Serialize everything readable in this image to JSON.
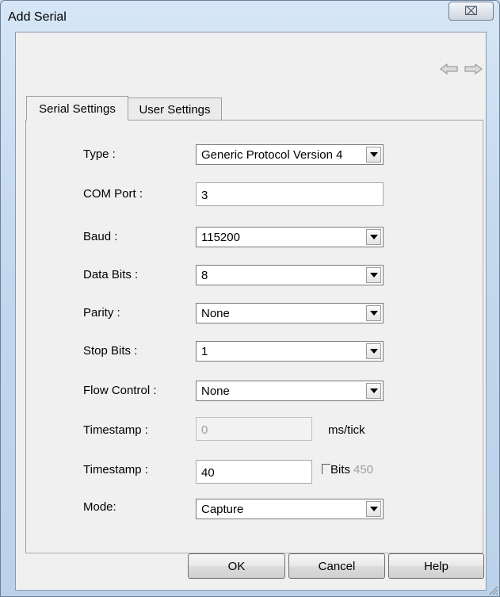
{
  "window": {
    "title": "Add Serial",
    "close_glyph": "⌧"
  },
  "nav": {
    "back_icon": "back-arrow-icon",
    "forward_icon": "forward-arrow-icon"
  },
  "tabs": [
    {
      "label": "Serial Settings",
      "active": true
    },
    {
      "label": "User Settings",
      "active": false
    }
  ],
  "fields": {
    "type": {
      "label": "Type :",
      "value": "Generic Protocol Version 4"
    },
    "com_port": {
      "label": "COM Port :",
      "value": "3"
    },
    "baud": {
      "label": "Baud :",
      "value": "115200"
    },
    "data_bits": {
      "label": "Data Bits :",
      "value": "8"
    },
    "parity": {
      "label": "Parity :",
      "value": "None"
    },
    "stop_bits": {
      "label": "Stop Bits :",
      "value": "1"
    },
    "flow_control": {
      "label": "Flow Control :",
      "value": "None"
    },
    "timestamp_ms": {
      "label": "Timestamp :",
      "value": "0",
      "unit": "ms/tick"
    },
    "timestamp_bits": {
      "label": "Timestamp :",
      "value": "40",
      "checkbox_label": "Bits",
      "extra": "450"
    },
    "mode": {
      "label": "Mode:",
      "value": "Capture"
    }
  },
  "buttons": {
    "ok": "OK",
    "cancel": "Cancel",
    "help": "Help"
  },
  "colors": {
    "titlebar": "#cfe0f2",
    "client": "#f0f0f0"
  }
}
